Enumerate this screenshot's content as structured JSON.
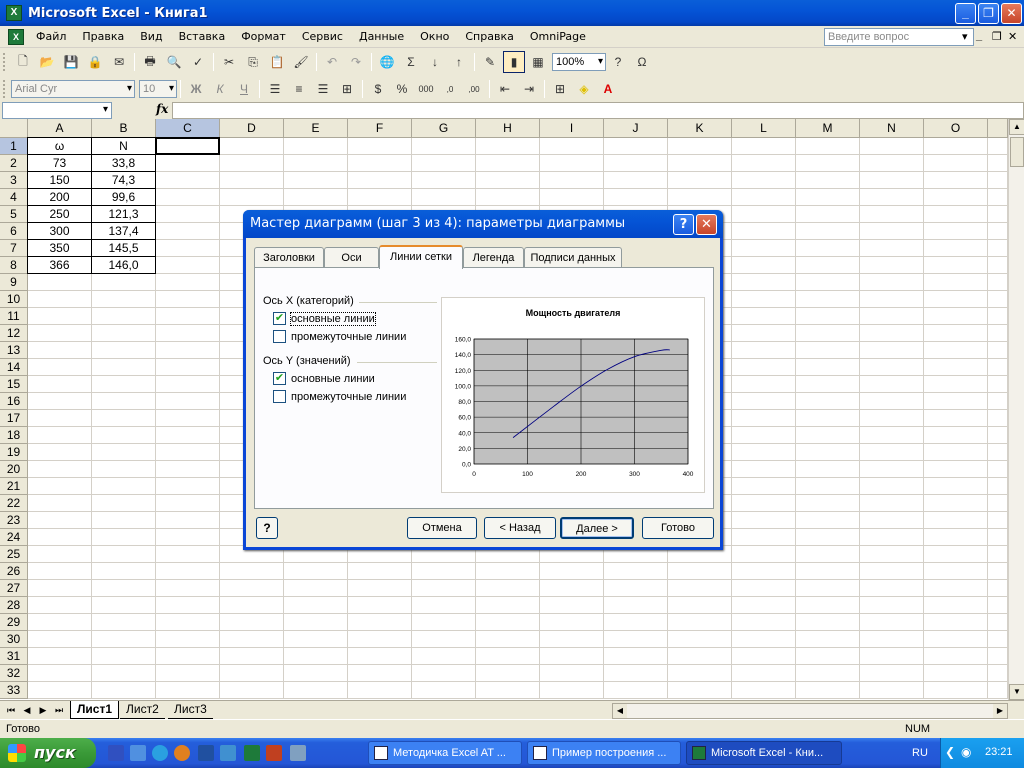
{
  "window": {
    "title": "Microsoft Excel - Книга1"
  },
  "menu": {
    "items": [
      "Файл",
      "Правка",
      "Вид",
      "Вставка",
      "Формат",
      "Сервис",
      "Данные",
      "Окно",
      "Справка",
      "OmniPage"
    ],
    "help_placeholder": "Введите вопрос"
  },
  "toolbar": {
    "zoom": "100%",
    "font_name": "Arial Cyr",
    "font_size": "10"
  },
  "formula_bar": {
    "name_box": "",
    "fx_label": "fx",
    "content": ""
  },
  "grid": {
    "columns": [
      "A",
      "B",
      "C",
      "D",
      "E",
      "F",
      "G",
      "H",
      "I",
      "J",
      "K",
      "L",
      "M",
      "N",
      "O"
    ],
    "rows": [
      "1",
      "2",
      "3",
      "4",
      "5",
      "6",
      "7",
      "8",
      "9",
      "10",
      "11",
      "12",
      "13",
      "14",
      "15",
      "16",
      "17",
      "18",
      "19",
      "20",
      "21",
      "22",
      "23",
      "24",
      "25",
      "26",
      "27",
      "28",
      "29",
      "30",
      "31",
      "32",
      "33"
    ],
    "data": [
      [
        "ω",
        "N"
      ],
      [
        "73",
        "33,8"
      ],
      [
        "150",
        "74,3"
      ],
      [
        "200",
        "99,6"
      ],
      [
        "250",
        "121,3"
      ],
      [
        "300",
        "137,4"
      ],
      [
        "350",
        "145,5"
      ],
      [
        "366",
        "146,0"
      ]
    ],
    "active_cell": "C1"
  },
  "sheets": {
    "tabs": [
      "Лист1",
      "Лист2",
      "Лист3"
    ],
    "active": "Лист1"
  },
  "status": {
    "left": "Готово",
    "right": "NUM"
  },
  "dialog": {
    "title": "Мастер диаграмм (шаг 3 из 4): параметры диаграммы",
    "tabs": [
      "Заголовки",
      "Оси",
      "Линии сетки",
      "Легенда",
      "Подписи данных"
    ],
    "active_tab": "Линии сетки",
    "x_group": "Ось X (категорий)",
    "y_group": "Ось Y (значений)",
    "options": {
      "major": "основные линии",
      "minor": "промежуточные линии"
    },
    "x_major_checked": true,
    "x_minor_checked": false,
    "y_major_checked": true,
    "y_minor_checked": false,
    "buttons": {
      "help": "?",
      "cancel": "Отмена",
      "back": "< Назад",
      "next": "Далее >",
      "finish": "Готово"
    }
  },
  "chart_data": {
    "type": "scatter",
    "title": "Мощность двигателя",
    "x": [
      73,
      150,
      200,
      250,
      300,
      350,
      366
    ],
    "values": [
      33.8,
      74.3,
      99.6,
      121.3,
      137.4,
      145.5,
      146.0
    ],
    "xlim": [
      0,
      400
    ],
    "ylim": [
      0,
      160
    ],
    "x_ticks": [
      "0",
      "100",
      "200",
      "300",
      "400"
    ],
    "y_ticks": [
      "0,0",
      "20,0",
      "40,0",
      "60,0",
      "80,0",
      "100,0",
      "120,0",
      "140,0",
      "160,0"
    ],
    "plot_background": "#c0c0c0",
    "line_color": "#000080",
    "grid_x": true,
    "grid_y": true,
    "legend": "none"
  },
  "taskbar": {
    "start": "пуск",
    "tasks": [
      "Методичка Excel AT ...",
      "Пример построения ...",
      "Microsoft Excel - Кни..."
    ],
    "active_task": 2,
    "language": "RU",
    "clock": "23:21"
  }
}
